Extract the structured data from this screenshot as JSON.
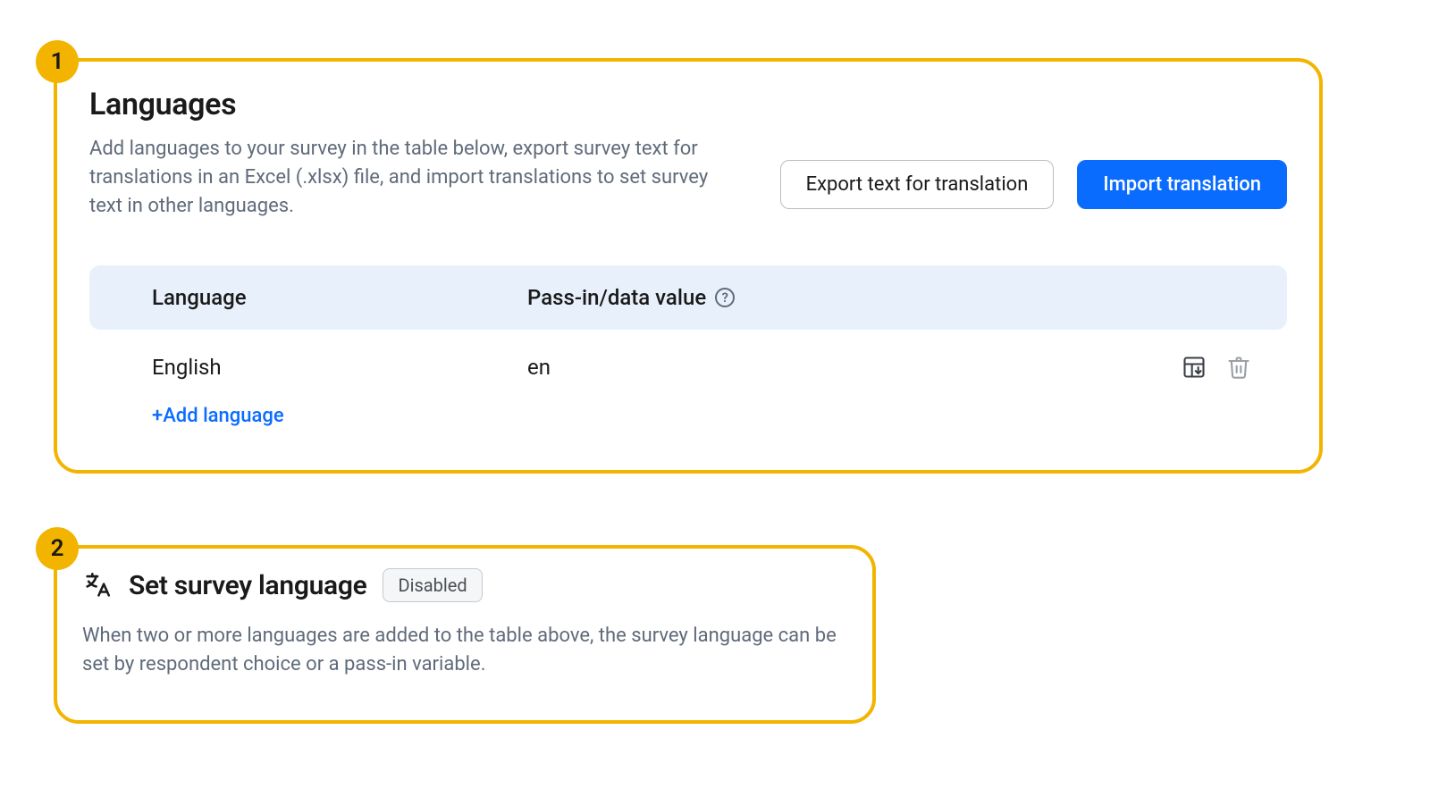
{
  "annotations": {
    "badge1": "1",
    "badge2": "2"
  },
  "languages_panel": {
    "title": "Languages",
    "description": "Add languages to your survey in the table below, export survey text for translations in an Excel (.xlsx) file, and import translations to set survey text in other languages.",
    "export_button": "Export text for translation",
    "import_button": "Import translation",
    "table": {
      "col_language": "Language",
      "col_value": "Pass-in/data value",
      "rows": [
        {
          "language": "English",
          "value": "en"
        }
      ]
    },
    "add_language": "+Add language"
  },
  "survey_language_panel": {
    "title": "Set survey language",
    "status": "Disabled",
    "description": "When two or more languages are added to the table above, the survey language can be set by respondent choice or a pass-in variable."
  }
}
